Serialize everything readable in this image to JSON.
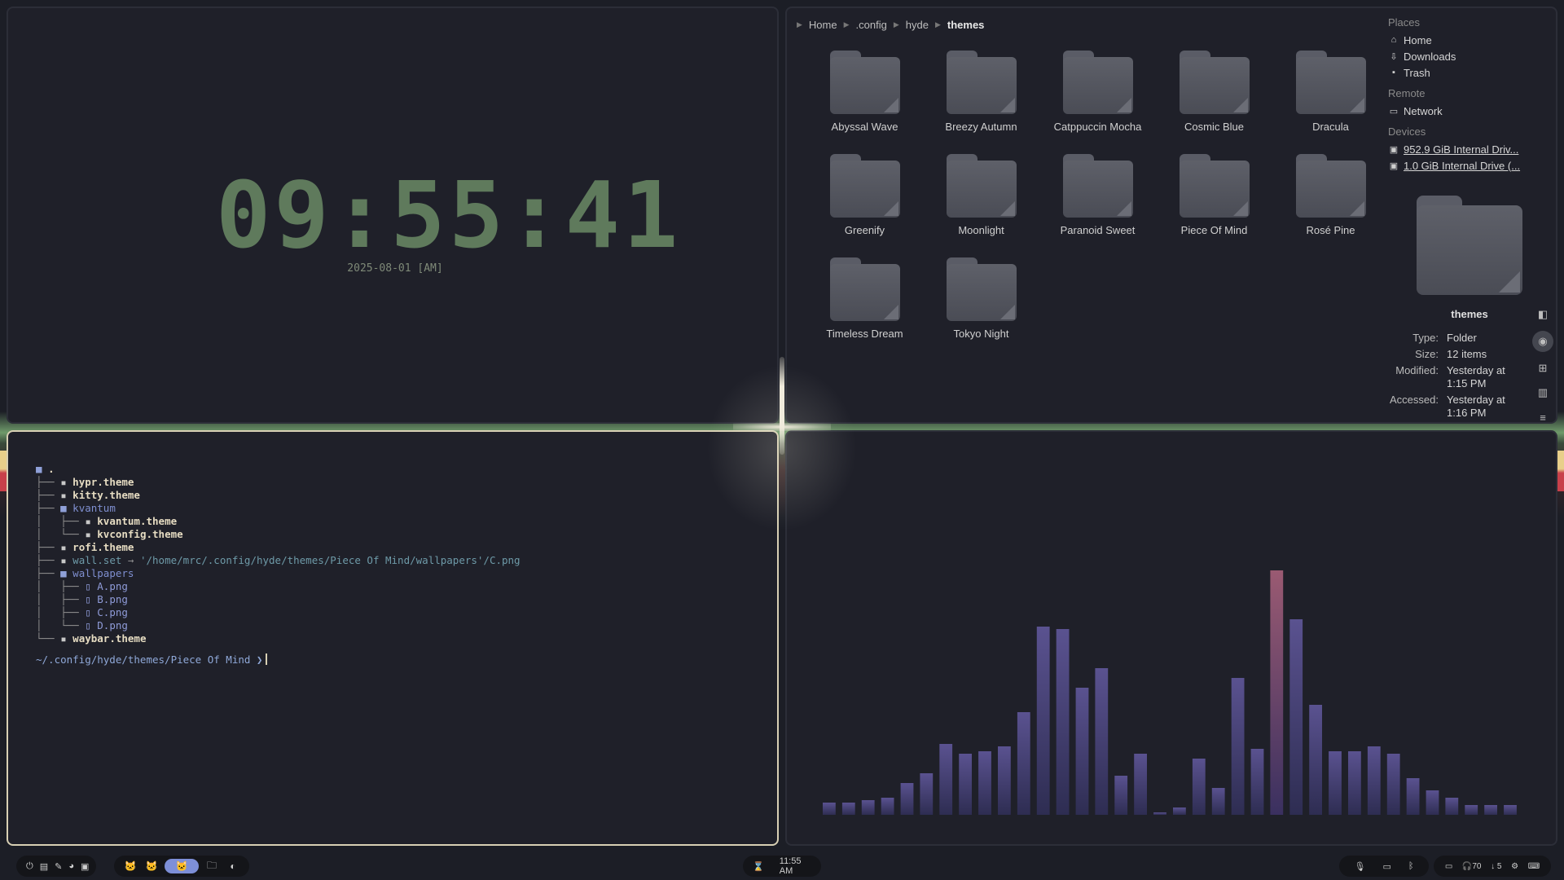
{
  "clock": {
    "time": "09:55:41",
    "date": "2025-08-01 [AM]"
  },
  "files": {
    "breadcrumbs": [
      "Home",
      ".config",
      "hyde",
      "themes"
    ],
    "folders": [
      "Abyssal Wave",
      "Breezy Autumn",
      "Catppuccin Mocha",
      "Cosmic Blue",
      "Dracula",
      "Greenify",
      "Moonlight",
      "Paranoid Sweet",
      "Piece Of Mind",
      "Rosé Pine",
      "Timeless Dream",
      "Tokyo Night"
    ],
    "sidebar": {
      "places_title": "Places",
      "places": [
        {
          "icon": "home-icon",
          "label": "Home"
        },
        {
          "icon": "download-icon",
          "label": "Downloads"
        },
        {
          "icon": "trash-icon",
          "label": "Trash"
        }
      ],
      "remote_title": "Remote",
      "remote": [
        {
          "icon": "network-folder-icon",
          "label": "Network"
        }
      ],
      "devices_title": "Devices",
      "devices": [
        {
          "icon": "drive-icon",
          "label": "952.9 GiB Internal Driv..."
        },
        {
          "icon": "drive-icon",
          "label": "1.0 GiB Internal Drive (..."
        }
      ]
    },
    "preview": {
      "name": "themes",
      "type_label": "Type:",
      "type": "Folder",
      "size_label": "Size:",
      "size": "12 items",
      "modified_label": "Modified:",
      "modified": "Yesterday at 1:15 PM",
      "accessed_label": "Accessed:",
      "accessed": "Yesterday at 1:16 PM"
    }
  },
  "terminal": {
    "root": ".",
    "entries": [
      {
        "prefix": "├── ",
        "kind": "file",
        "name": "hypr.theme"
      },
      {
        "prefix": "├── ",
        "kind": "file",
        "name": "kitty.theme"
      },
      {
        "prefix": "├── ",
        "kind": "dir",
        "name": "kvantum"
      },
      {
        "prefix": "│   ├── ",
        "kind": "file",
        "name": "kvantum.theme"
      },
      {
        "prefix": "│   └── ",
        "kind": "file",
        "name": "kvconfig.theme"
      },
      {
        "prefix": "├── ",
        "kind": "file",
        "name": "rofi.theme"
      },
      {
        "prefix": "├── ",
        "kind": "link",
        "name": "wall.set",
        "target": "'/home/mrc/.config/hyde/themes/Piece Of Mind/wallpapers'/C.png"
      },
      {
        "prefix": "├── ",
        "kind": "dir",
        "name": "wallpapers"
      },
      {
        "prefix": "│   ├── ",
        "kind": "png",
        "name": "A.png"
      },
      {
        "prefix": "│   ├── ",
        "kind": "png",
        "name": "B.png"
      },
      {
        "prefix": "│   ├── ",
        "kind": "png",
        "name": "C.png"
      },
      {
        "prefix": "│   └── ",
        "kind": "png",
        "name": "D.png"
      },
      {
        "prefix": "└── ",
        "kind": "file",
        "name": "waybar.theme"
      }
    ],
    "link_arrow": "→",
    "prompt": "~/.config/hyde/themes/Piece Of Mind ❯"
  },
  "visualizer": {
    "bar_color": "#4a4a7a",
    "peak_color": "#8a5570",
    "levels": [
      0.05,
      0.05,
      0.06,
      0.07,
      0.13,
      0.17,
      0.29,
      0.25,
      0.26,
      0.28,
      0.42,
      0.77,
      0.76,
      0.52,
      0.6,
      0.16,
      0.25,
      0.01,
      0.03,
      0.23,
      0.11,
      0.56,
      0.27,
      1.0,
      0.8,
      0.45,
      0.26,
      0.26,
      0.28,
      0.25,
      0.15,
      0.1,
      0.07,
      0.04,
      0.04,
      0.04
    ]
  },
  "taskbar": {
    "left_icons": [
      "power-icon",
      "files-icon",
      "edit-icon",
      "palette-icon",
      "clipboard-icon"
    ],
    "workspaces": [
      "cat-icon",
      "cat-icon",
      "cat-icon",
      "folder-icon",
      "firefox-icon"
    ],
    "clock": "11:55 AM",
    "tray": [
      "mic-icon",
      "screen-icon",
      "bluetooth-icon"
    ],
    "status": "70",
    "status2": "5"
  }
}
